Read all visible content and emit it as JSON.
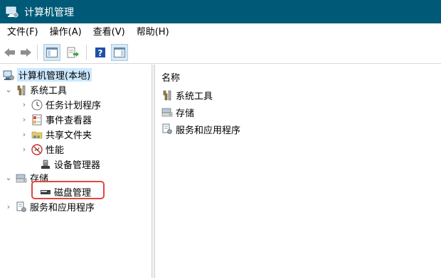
{
  "window": {
    "title": "计算机管理",
    "title_icon": "computer-management-icon"
  },
  "menu": [
    "文件(F)",
    "操作(A)",
    "查看(V)",
    "帮助(H)"
  ],
  "toolbar": {
    "buttons": [
      "back-arrow-icon",
      "forward-arrow-icon",
      "show-hide-console-tree-icon",
      "export-list-icon",
      "help-icon",
      "show-hide-action-pane-icon"
    ]
  },
  "tree": {
    "root": "计算机管理(本地)",
    "system_tools": "系统工具",
    "task_scheduler": "任务计划程序",
    "event_viewer": "事件查看器",
    "shared_folders": "共享文件夹",
    "performance": "性能",
    "device_manager": "设备管理器",
    "storage": "存储",
    "disk_management": "磁盘管理",
    "services_apps": "服务和应用程序"
  },
  "list": {
    "column_name": "名称",
    "items": [
      "系统工具",
      "存储",
      "服务和应用程序"
    ]
  },
  "colors": {
    "titlebar": "#005a77",
    "selection": "#cce8ff",
    "highlight_border": "#e0473f"
  }
}
